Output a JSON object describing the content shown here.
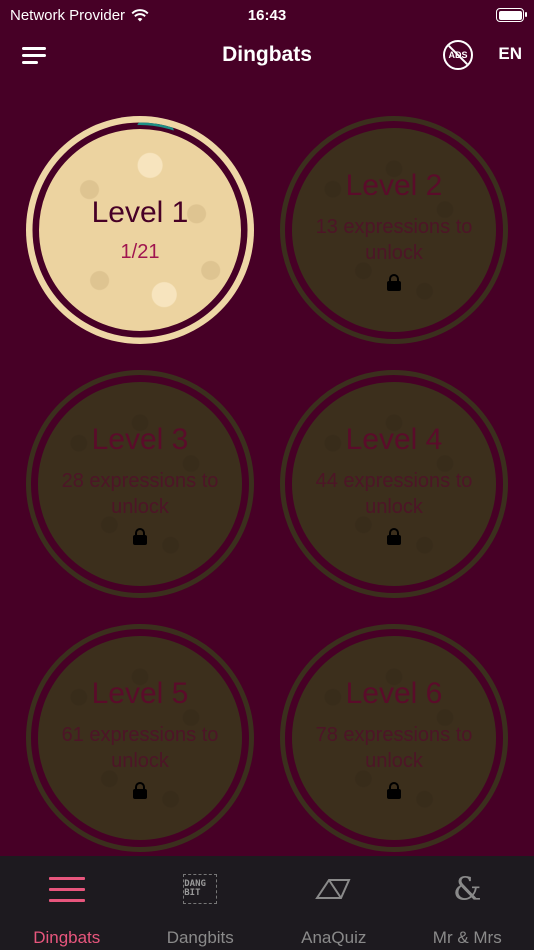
{
  "status_bar": {
    "carrier": "Network Provider",
    "time": "16:43"
  },
  "header": {
    "title": "Dingbats",
    "ads_label": "ADS",
    "language": "EN"
  },
  "levels": [
    {
      "title": "Level 1",
      "progress": "1/21",
      "progress_fraction": 0.048,
      "state": "unlocked"
    },
    {
      "title": "Level 2",
      "unlock_text": "13 expressions to unlock",
      "state": "locked"
    },
    {
      "title": "Level 3",
      "unlock_text": "28 expressions to unlock",
      "state": "locked"
    },
    {
      "title": "Level 4",
      "unlock_text": "44 expressions to unlock",
      "state": "locked"
    },
    {
      "title": "Level 5",
      "unlock_text": "61 expressions to unlock",
      "state": "locked"
    },
    {
      "title": "Level 6",
      "unlock_text": "78 expressions to unlock",
      "state": "locked"
    }
  ],
  "tabs": [
    {
      "label": "Dingbats",
      "icon": "menu-lines-icon",
      "active": true
    },
    {
      "label": "Dangbits",
      "icon": "dangbit-logo-icon",
      "logo_text": "DANG BIT",
      "active": false
    },
    {
      "label": "AnaQuiz",
      "icon": "anaquiz-shape-icon",
      "active": false
    },
    {
      "label": "Mr & Mrs",
      "icon": "ampersand-icon",
      "active": false
    }
  ],
  "colors": {
    "background": "#470026",
    "accent": "#e8567d",
    "progress": "#1e8f86",
    "card_unlocked": "#ecd3a0",
    "card_locked": "#3c2f1c"
  }
}
